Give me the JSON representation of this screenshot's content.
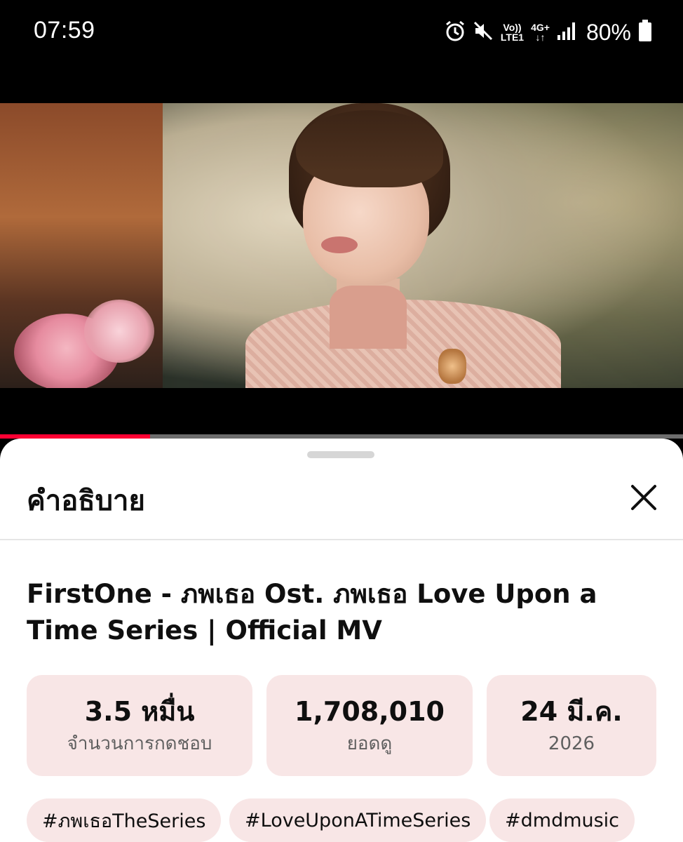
{
  "status_bar": {
    "time": "07:59",
    "icons": [
      "alarm-icon",
      "mute-icon",
      "volte-icon",
      "4g-plus-icon",
      "signal-icon",
      "battery-icon"
    ],
    "volte_line1": "Vo))",
    "volte_line2": "LTE1",
    "network_type": "4G+",
    "battery_percent": "80%"
  },
  "player": {
    "progress_fraction": 0.22,
    "progress_color": "#ff0033"
  },
  "sheet": {
    "title": "คำอธิบาย",
    "close_icon": "close-icon",
    "video_title": "FirstOne - ภพเธอ Ost. ภพเธอ Love Upon a Time Series | Official MV",
    "stats": [
      {
        "value": "3.5 หมื่น",
        "label": "จำนวนการกดชอบ"
      },
      {
        "value": "1,708,010",
        "label": "ยอดดู"
      },
      {
        "value": "24 มี.ค.",
        "label": "2026"
      }
    ],
    "hashtags": [
      "#ภพเธอTheSeries",
      "#LoveUponATimeSeries",
      "#dmdmusic"
    ],
    "chip_color": "#f8e6e6"
  }
}
